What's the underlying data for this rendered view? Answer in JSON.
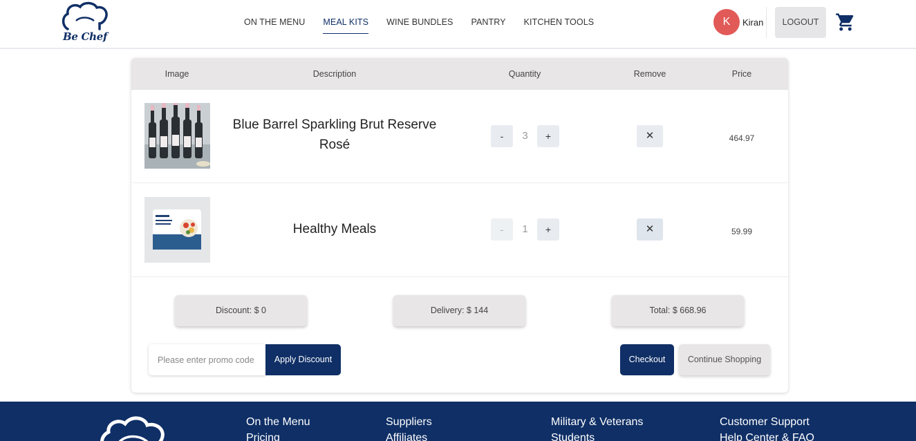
{
  "brand": {
    "logo_text": "Be Chef",
    "primary_color": "#0f2f66",
    "avatar_color": "#e15a57"
  },
  "nav": {
    "items": [
      {
        "label": "ON THE MENU",
        "active": false
      },
      {
        "label": "MEAL KITS",
        "active": true
      },
      {
        "label": "WINE BUNDLES",
        "active": false
      },
      {
        "label": "PANTRY",
        "active": false
      },
      {
        "label": "KITCHEN TOOLS",
        "active": false
      }
    ]
  },
  "user": {
    "initial": "K",
    "name": "Kiran",
    "logout_label": "LOGOUT"
  },
  "cart_table": {
    "headers": {
      "image": "Image",
      "description": "Description",
      "quantity": "Quantity",
      "remove": "Remove",
      "price": "Price"
    },
    "items": [
      {
        "description": "Blue Barrel Sparkling Brut Reserve Rosé",
        "quantity": "3",
        "minus": "-",
        "plus": "+",
        "remove": "✕",
        "price": "464.97",
        "image_icon": "wine-bottles-photo"
      },
      {
        "description": "Healthy Meals",
        "quantity": "1",
        "minus": "-",
        "plus": "+",
        "remove": "✕",
        "price": "59.99",
        "image_icon": "meal-kit-box-photo"
      }
    ]
  },
  "summary": {
    "discount": "Discount: $ 0",
    "delivery": "Delivery: $ 144",
    "total": "Total: $ 668.96"
  },
  "promo": {
    "placeholder": "Please enter promo code",
    "apply_label": "Apply Discount"
  },
  "actions": {
    "checkout_label": "Checkout",
    "continue_label": "Continue Shopping"
  },
  "footer": {
    "columns": [
      [
        "On the Menu",
        "Pricing"
      ],
      [
        "Suppliers",
        "Affiliates"
      ],
      [
        "Military & Veterans",
        "Students"
      ],
      [
        "Customer Support",
        "Help Center & FAQ"
      ]
    ]
  }
}
